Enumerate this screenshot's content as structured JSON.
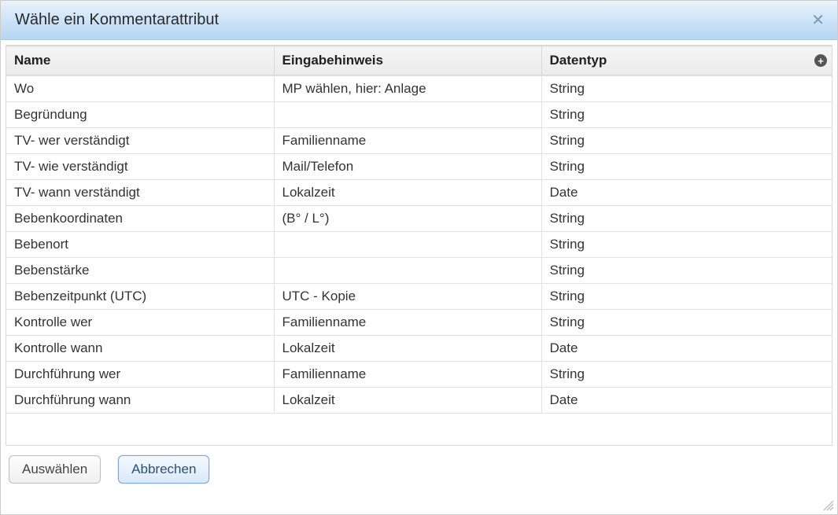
{
  "dialog": {
    "title": "Wähle ein Kommentarattribut",
    "close_icon": "close-icon"
  },
  "table": {
    "columns": {
      "name": "Name",
      "hint": "Eingabehinweis",
      "type": "Datentyp"
    },
    "rows": [
      {
        "name": "Wo",
        "hint": "MP wählen, hier: Anlage",
        "type": "String"
      },
      {
        "name": "Begründung",
        "hint": "",
        "type": "String"
      },
      {
        "name": "TV- wer verständigt",
        "hint": "Familienname",
        "type": "String"
      },
      {
        "name": "TV- wie verständigt",
        "hint": "Mail/Telefon",
        "type": "String"
      },
      {
        "name": "TV- wann verständigt",
        "hint": "Lokalzeit",
        "type": "Date"
      },
      {
        "name": "Bebenkoordinaten",
        "hint": "(B° / L°)",
        "type": "String"
      },
      {
        "name": "Bebenort",
        "hint": "",
        "type": "String"
      },
      {
        "name": "Bebenstärke",
        "hint": "",
        "type": "String"
      },
      {
        "name": "Bebenzeitpunkt (UTC)",
        "hint": "UTC - Kopie",
        "type": "String"
      },
      {
        "name": "Kontrolle wer",
        "hint": "Familienname",
        "type": "String"
      },
      {
        "name": "Kontrolle wann",
        "hint": "Lokalzeit",
        "type": "Date"
      },
      {
        "name": "Durchführung wer",
        "hint": "Familienname",
        "type": "String"
      },
      {
        "name": "Durchführung wann",
        "hint": "Lokalzeit",
        "type": "Date"
      }
    ]
  },
  "buttons": {
    "select": "Auswählen",
    "cancel": "Abbrechen"
  }
}
